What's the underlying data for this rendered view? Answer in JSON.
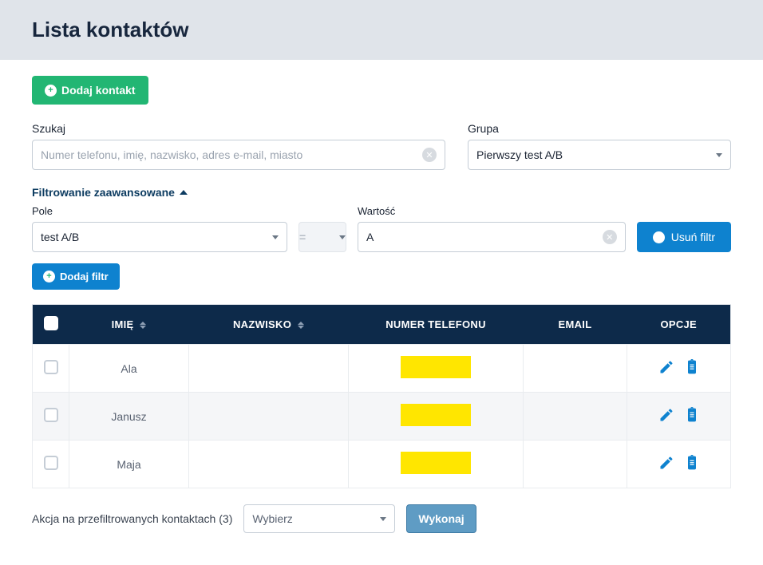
{
  "page_title": "Lista kontaktów",
  "add_contact_label": "Dodaj kontakt",
  "search": {
    "label": "Szukaj",
    "placeholder": "Numer telefonu, imię, nazwisko, adres e-mail, miasto",
    "value": ""
  },
  "group": {
    "label": "Grupa",
    "selected": "Pierwszy test A/B"
  },
  "advanced_filter_label": "Filtrowanie zaawansowane",
  "filter": {
    "field_label": "Pole",
    "field_value": "test A/B",
    "operator": "=",
    "value_label": "Wartość",
    "value": "A",
    "remove_label": "Usuń filtr",
    "add_label": "Dodaj filtr"
  },
  "table": {
    "headers": {
      "imie": "IMIĘ",
      "nazwisko": "NAZWISKO",
      "numer": "NUMER TELEFONU",
      "email": "EMAIL",
      "opcje": "OPCJE"
    },
    "rows": [
      {
        "imie": "Ala",
        "nazwisko": "",
        "numer": "",
        "email": ""
      },
      {
        "imie": "Janusz",
        "nazwisko": "",
        "numer": "",
        "email": ""
      },
      {
        "imie": "Maja",
        "nazwisko": "",
        "numer": "",
        "email": ""
      }
    ]
  },
  "action": {
    "label_prefix": "Akcja na przefiltrowanych kontaktach",
    "count": 3,
    "select_placeholder": "Wybierz",
    "execute_label": "Wykonaj"
  }
}
